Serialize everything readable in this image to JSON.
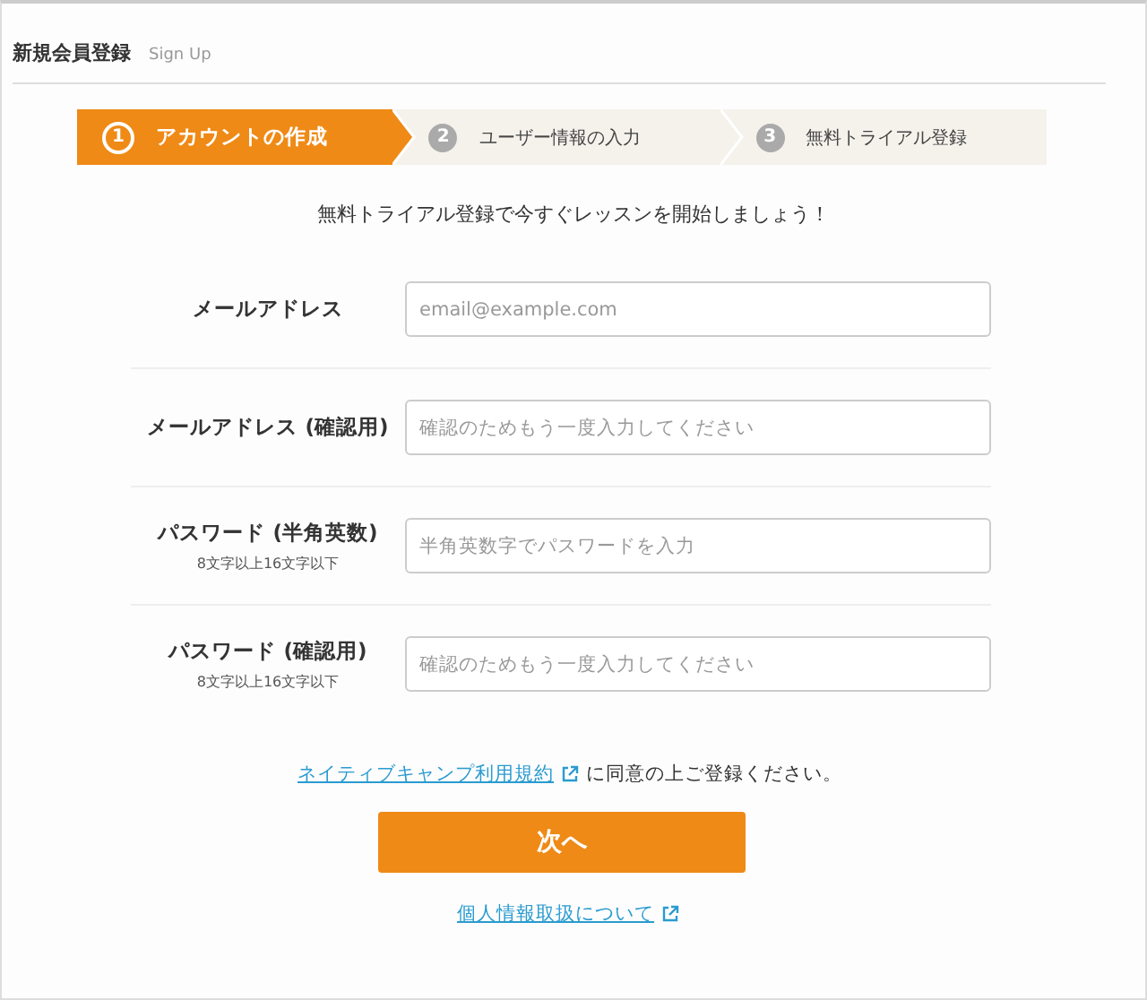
{
  "header": {
    "title": "新規会員登録",
    "subtitle": "Sign Up"
  },
  "steps": [
    {
      "number": "1",
      "label": "アカウントの作成",
      "selected": true
    },
    {
      "number": "2",
      "label": "ユーザー情報の入力",
      "selected": false
    },
    {
      "number": "3",
      "label": "無料トライアル登録",
      "selected": false
    }
  ],
  "intro": "無料トライアル登録で今すぐレッスンを開始しましょう！",
  "fields": [
    {
      "label": "メールアドレス",
      "placeholder": "email@example.com"
    },
    {
      "label": "メールアドレス (確認用)",
      "placeholder": "確認のためもう一度入力してください"
    },
    {
      "label": "パスワード (半角英数)",
      "note": "8文字以上16文字以下",
      "placeholder": "半角英数字でパスワードを入力"
    },
    {
      "label": "パスワード (確認用)",
      "note": "8文字以上16文字以下",
      "placeholder": "確認のためもう一度入力してください"
    }
  ],
  "terms": {
    "link": "ネイティブキャンプ利用規約",
    "text": "に同意の上ご登録ください。"
  },
  "next_button": "次へ",
  "privacy_link": "個人情報取扱について"
}
